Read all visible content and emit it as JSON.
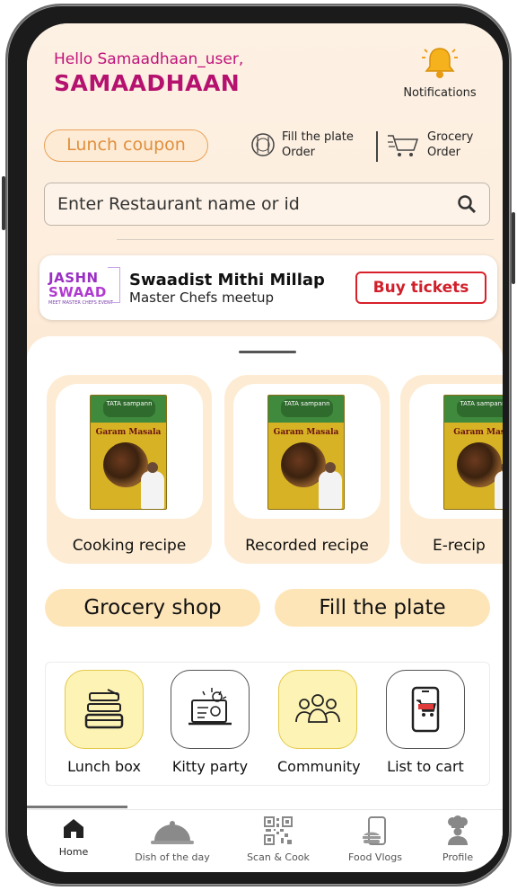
{
  "header": {
    "greeting": "Hello Samaadhaan_user,",
    "brand": "SAMAADHAAN",
    "notifications_label": "Notifications"
  },
  "quick_actions": {
    "coupon": "Lunch coupon",
    "fill_plate_line1": "Fill the plate",
    "fill_plate_line2": "Order",
    "grocery_line1": "Grocery",
    "grocery_line2": "Order"
  },
  "search": {
    "placeholder": "Enter Restaurant name or id"
  },
  "banner": {
    "logo_line1": "JASHN",
    "logo_line2": "SWAAD",
    "logo_tag": "MEET MASTER CHEFS EVENT",
    "title": "Swaadist Mithi Millap",
    "subtitle": "Master Chefs meetup",
    "button": "Buy tickets"
  },
  "recipe_cards": [
    {
      "label": "Cooking recipe",
      "pack_brand": "TATA sampann",
      "pack_name": "Garam Masala"
    },
    {
      "label": "Recorded recipe",
      "pack_brand": "TATA sampann",
      "pack_name": "Garam Masala"
    },
    {
      "label": "E-recip",
      "pack_brand": "TATA sampann",
      "pack_name": "Garam Masa"
    }
  ],
  "pills": {
    "grocery": "Grocery shop",
    "fill": "Fill the plate"
  },
  "icon_tiles": [
    {
      "label": "Lunch box",
      "icon": "lunch-box-icon"
    },
    {
      "label": "Kitty party",
      "icon": "kitty-party-icon"
    },
    {
      "label": "Community",
      "icon": "community-icon"
    },
    {
      "label": "List to cart",
      "icon": "cart-list-icon"
    }
  ],
  "bottom_nav": [
    {
      "label": "Home",
      "icon": "home-icon"
    },
    {
      "label": "Dish of the day",
      "icon": "cloche-icon"
    },
    {
      "label": "Scan & Cook",
      "icon": "qr-code-icon"
    },
    {
      "label": "Food Vlogs",
      "icon": "food-vlog-icon"
    },
    {
      "label": "Profile",
      "icon": "chef-icon"
    }
  ],
  "colors": {
    "brand": "#b5126f",
    "accent": "#e08f3f",
    "cta": "#d11f2a",
    "pill": "#fde5b8"
  }
}
